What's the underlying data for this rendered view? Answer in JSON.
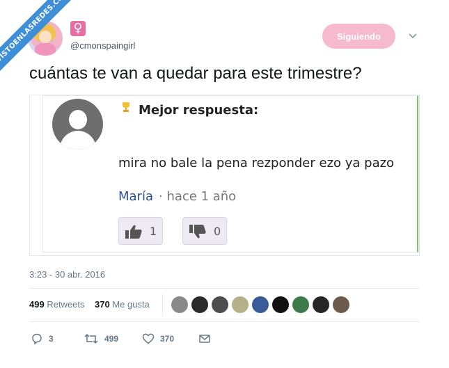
{
  "watermark": "VISTOENLASREDES.COM",
  "header": {
    "venus_symbol": "♀",
    "handle": "@cmonspaingirl",
    "follow_label": "Siguiendo"
  },
  "tweet": {
    "text": "cuántas te van a quedar para este trimestre?",
    "timestamp": "3:23 - 30 abr. 2016"
  },
  "embedded_answer": {
    "label": "Mejor respuesta:",
    "answer": "mira no bale la pena rezponder ezo ya pazo",
    "author": "María",
    "time": "· hace 1 año",
    "thumbs_up_count": "1",
    "thumbs_down_count": "0"
  },
  "stats": {
    "retweets_count": "499",
    "retweets_label": "Retweets",
    "likes_count": "370",
    "likes_label": "Me gusta"
  },
  "likers": [
    "#8a8a8a",
    "#2b2b2b",
    "#4d4d4d",
    "#b5b08a",
    "#3a5a9a",
    "#111111",
    "#3c7a4c",
    "#262626",
    "#6d5a4a"
  ],
  "actions": {
    "replies": "3",
    "retweets": "499",
    "likes": "370"
  },
  "colors": {
    "ribbon": "#3f8ed8",
    "follow_button": "#f6b9cd",
    "venus_badge": "#e76e9d",
    "author_link": "#2c4f8f"
  }
}
